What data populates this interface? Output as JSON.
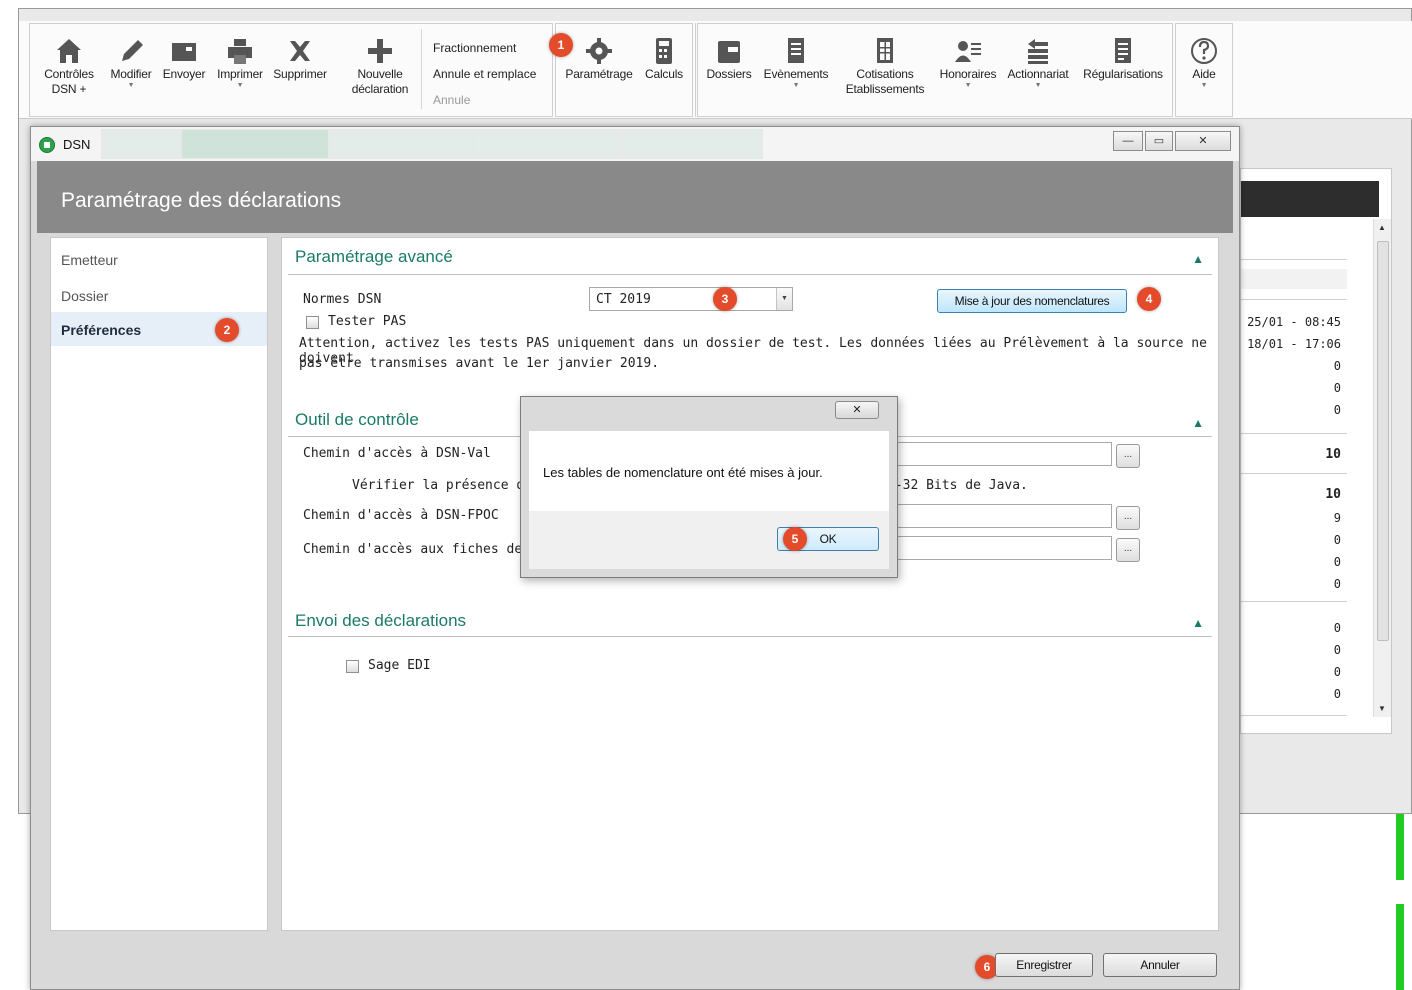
{
  "toolbar": {
    "controles": "Contrôles DSN +",
    "modifier": "Modifier",
    "envoyer": "Envoyer",
    "imprimer": "Imprimer",
    "supprimer": "Supprimer",
    "nouvelle_declaration": "Nouvelle déclaration",
    "fractionnement": "Fractionnement",
    "annule_remplace": "Annule et remplace",
    "annule": "Annule",
    "parametrage": "Paramétrage",
    "calculs": "Calculs",
    "dossiers": "Dossiers",
    "evenements": "Evènements",
    "cotisations": "Cotisations Etablissements",
    "honoraires": "Honoraires",
    "actionnariat": "Actionnariat",
    "regularisations": "Régularisations",
    "aide": "Aide"
  },
  "background_panel": {
    "dates": [
      "25/01 - 08:45",
      "18/01 - 17:06"
    ],
    "values": [
      "0",
      "0",
      "0",
      "10",
      "10",
      "9",
      "0",
      "0",
      "0",
      "0",
      "0",
      "0",
      "0"
    ]
  },
  "window": {
    "title": "DSN",
    "header": "Paramétrage des déclarations",
    "minimize": "—",
    "maximize": "▭",
    "close": "✕"
  },
  "nav": {
    "items": [
      {
        "label": "Emetteur",
        "selected": false
      },
      {
        "label": "Dossier",
        "selected": false
      },
      {
        "label": "Préférences",
        "selected": true
      }
    ]
  },
  "sections": {
    "avance": {
      "title": "Paramétrage avancé",
      "normes_label": "Normes DSN",
      "normes_value": "CT 2019",
      "tester_pas": "Tester PAS",
      "attention_line1": "Attention, activez les tests PAS uniquement dans un dossier de test. Les données liées au Prélèvement à la source ne doivent",
      "attention_line2": "pas être transmises avant le 1er janvier 2019.",
      "maj_button": "Mise à jour des nomenclatures"
    },
    "controle": {
      "title": "Outil de contrôle",
      "dsnval_label": "Chemin d'accès à DSN-Val",
      "verifier_prefix": "Vérifier la présence de la v",
      "verifier_suffix": "6-32 Bits de Java.",
      "fpoc_label": "Chemin d'accès à DSN-FPOC",
      "fiches_label": "Chemin d'accès aux fiches de para",
      "browse": "..."
    },
    "envoi": {
      "title": "Envoi des déclarations",
      "sage_edi": "Sage EDI"
    }
  },
  "dialog": {
    "close": "✕",
    "message": "Les tables de nomenclature ont été mises à jour.",
    "ok": "OK"
  },
  "footer": {
    "enregistrer": "Enregistrer",
    "annuler": "Annuler"
  },
  "badges": [
    "1",
    "2",
    "3",
    "4",
    "5",
    "6"
  ],
  "colors": {
    "badge": "#e34b2a",
    "section_title": "#1a7a6a",
    "header_bg": "#898989",
    "selected_nav": "#e6eef7"
  }
}
